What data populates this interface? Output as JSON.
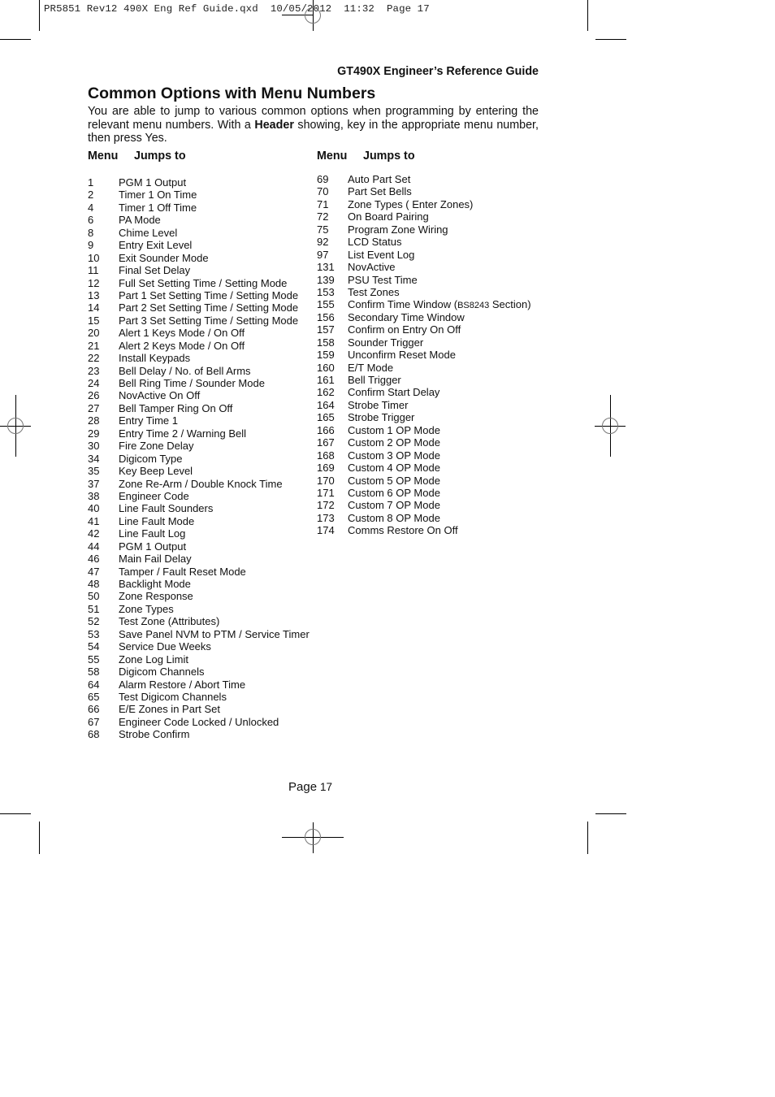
{
  "slug": "PR5851 Rev12 490X Eng Ref Guide.qxd  10/05/2012  11:32  Page 17",
  "running_head": "GT490X Engineer’s Reference Guide",
  "title": "Common Options with Menu Numbers",
  "intro": {
    "before_bold": "You are able to jump to various common options when programming by entering the relevant menu numbers. With a ",
    "bold": "Header",
    "after_bold": " showing, key in the appropriate menu number, then press Yes."
  },
  "column_headers": {
    "menu": "Menu",
    "jumps_to": "Jumps to"
  },
  "left_items": [
    {
      "menu": "1",
      "label": "PGM 1 Output"
    },
    {
      "menu": "2",
      "label": "Timer 1 On Time"
    },
    {
      "menu": "4",
      "label": "Timer 1 Off Time"
    },
    {
      "menu": "6",
      "label": "PA Mode"
    },
    {
      "menu": "8",
      "label": "Chime Level"
    },
    {
      "menu": "9",
      "label": "Entry Exit Level"
    },
    {
      "menu": "10",
      "label": "Exit Sounder Mode"
    },
    {
      "menu": "11",
      "label": "Final Set Delay"
    },
    {
      "menu": "12",
      "label": "Full Set Setting Time / Setting Mode"
    },
    {
      "menu": "13",
      "label": "Part 1 Set Setting Time / Setting Mode"
    },
    {
      "menu": "14",
      "label": "Part 2 Set Setting Time / Setting Mode"
    },
    {
      "menu": "15",
      "label": "Part 3 Set Setting Time / Setting Mode"
    },
    {
      "menu": "20",
      "label": "Alert 1 Keys Mode / On Off"
    },
    {
      "menu": "21",
      "label": "Alert 2 Keys Mode / On Off"
    },
    {
      "menu": "22",
      "label": "Install Keypads"
    },
    {
      "menu": "23",
      "label": "Bell Delay / No. of Bell Arms"
    },
    {
      "menu": "24",
      "label": "Bell Ring Time / Sounder Mode"
    },
    {
      "menu": "26",
      "label": "NovActive On Off"
    },
    {
      "menu": "27",
      "label": "Bell Tamper Ring On Off"
    },
    {
      "menu": "28",
      "label": "Entry Time 1"
    },
    {
      "menu": "29",
      "label": "Entry Time 2 / Warning Bell"
    },
    {
      "menu": "30",
      "label": "Fire Zone Delay"
    },
    {
      "menu": "34",
      "label": "Digicom Type"
    },
    {
      "menu": "35",
      "label": "Key Beep Level"
    },
    {
      "menu": "37",
      "label": "Zone Re-Arm / Double Knock Time"
    },
    {
      "menu": "38",
      "label": "Engineer Code"
    },
    {
      "menu": "40",
      "label": "Line Fault Sounders"
    },
    {
      "menu": "41",
      "label": "Line Fault Mode"
    },
    {
      "menu": "42",
      "label": "Line Fault Log"
    },
    {
      "menu": "44",
      "label": "PGM 1 Output"
    },
    {
      "menu": "46",
      "label": "Main Fail Delay"
    },
    {
      "menu": "47",
      "label": "Tamper / Fault Reset Mode"
    },
    {
      "menu": "48",
      "label": "Backlight Mode"
    },
    {
      "menu": "50",
      "label": "Zone Response"
    },
    {
      "menu": "51",
      "label": "Zone Types"
    },
    {
      "menu": "52",
      "label": "Test Zone (Attributes)"
    },
    {
      "menu": "53",
      "label": "Save Panel NVM to PTM / Service Timer"
    },
    {
      "menu": "54",
      "label": "Service Due Weeks"
    },
    {
      "menu": "55",
      "label": "Zone Log Limit"
    },
    {
      "menu": "58",
      "label": "Digicom Channels"
    },
    {
      "menu": "64",
      "label": "Alarm Restore / Abort Time"
    },
    {
      "menu": "65",
      "label": "Test Digicom Channels"
    },
    {
      "menu": "66",
      "label": "E/E Zones in Part Set"
    },
    {
      "menu": "67",
      "label": "Engineer Code Locked / Unlocked"
    },
    {
      "menu": "68",
      "label": "Strobe Confirm"
    }
  ],
  "right_items": [
    {
      "menu": "69",
      "label": "Auto Part Set"
    },
    {
      "menu": "70",
      "label": "Part Set Bells"
    },
    {
      "menu": "71",
      "label": "Zone Types ( Enter Zones)"
    },
    {
      "menu": "72",
      "label": "On Board Pairing"
    },
    {
      "menu": "75",
      "label": "Program Zone Wiring"
    },
    {
      "menu": "92",
      "label": "LCD Status"
    },
    {
      "menu": "97",
      "label": "List Event Log"
    },
    {
      "menu": "131",
      "label": "NovActive"
    },
    {
      "menu": "139",
      "label": "PSU Test Time"
    },
    {
      "menu": "153",
      "label": "Test Zones"
    },
    {
      "menu": "155",
      "label": "Confirm Time Window (",
      "small": "BS8243",
      "label_after": " Section)"
    },
    {
      "menu": "156",
      "label": "Secondary Time Window"
    },
    {
      "menu": "157",
      "label": "Confirm on Entry On Off"
    },
    {
      "menu": "158",
      "label": "Sounder Trigger"
    },
    {
      "menu": "159",
      "label": "Unconfirm Reset Mode"
    },
    {
      "menu": "160",
      "label": "E/T Mode"
    },
    {
      "menu": "161",
      "label": "Bell Trigger"
    },
    {
      "menu": "162",
      "label": "Confirm Start Delay"
    },
    {
      "menu": "164",
      "label": "Strobe Timer"
    },
    {
      "menu": "165",
      "label": "Strobe Trigger"
    },
    {
      "menu": "166",
      "label": "Custom 1 OP Mode"
    },
    {
      "menu": "167",
      "label": "Custom 2 OP Mode"
    },
    {
      "menu": "168",
      "label": "Custom 3 OP Mode"
    },
    {
      "menu": "169",
      "label": "Custom 4 OP Mode"
    },
    {
      "menu": "170",
      "label": "Custom 5 OP Mode"
    },
    {
      "menu": "171",
      "label": "Custom 6 OP Mode"
    },
    {
      "menu": "172",
      "label": "Custom 7 OP Mode"
    },
    {
      "menu": "173",
      "label": "Custom 8 OP Mode"
    },
    {
      "menu": "174",
      "label": "Comms Restore On Off"
    }
  ],
  "footer": {
    "page_label": "Page",
    "page_number": "17"
  }
}
